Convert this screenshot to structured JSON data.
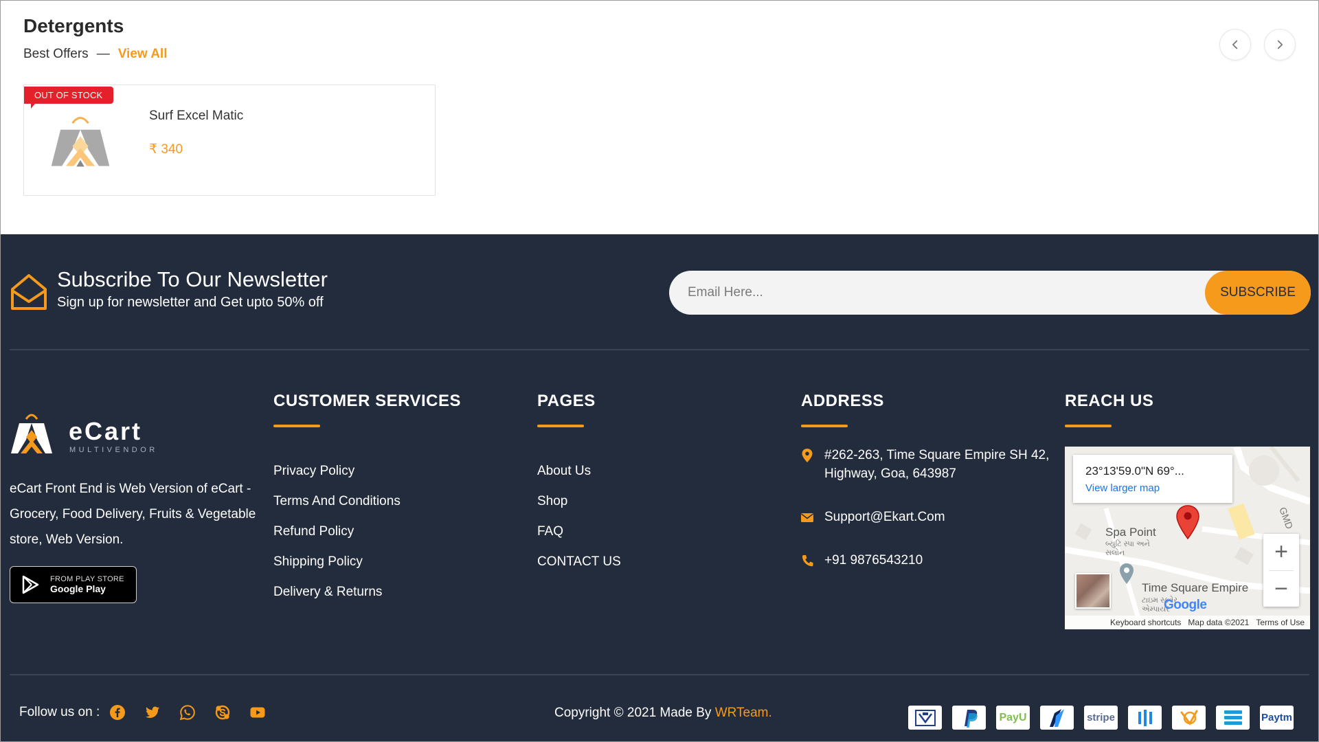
{
  "section": {
    "title": "Detergents",
    "subtitle": "Best Offers",
    "separator": "—",
    "view_all": "View All"
  },
  "product": {
    "badge": "OUT OF STOCK",
    "name": "Surf Excel Matic",
    "price": "₹ 340"
  },
  "newsletter": {
    "title": "Subscribe To Our Newsletter",
    "subtitle": "Sign up for newsletter and Get upto 50% off",
    "placeholder": "Email Here...",
    "button": "SUBSCRIBE"
  },
  "brand": {
    "logo_text": "eCart",
    "logo_sub": "MULTIVENDOR",
    "description": "eCart Front End is Web Version of eCart - Grocery, Food Delivery, Fruits & Vegetable store, Web Version.",
    "store_line1": "FROM PLAY STORE",
    "store_line2": "Google Play"
  },
  "customer_services": {
    "title": "CUSTOMER SERVICES",
    "links": [
      "Privacy Policy",
      "Terms And Conditions",
      "Refund Policy",
      "Shipping Policy",
      "Delivery & Returns"
    ]
  },
  "pages": {
    "title": "PAGES",
    "links": [
      "About Us",
      "Shop",
      "FAQ",
      "CONTACT US"
    ]
  },
  "address": {
    "title": "ADDRESS",
    "location": "#262-263, Time Square Empire SH 42, Highway, Goa, 643987",
    "email": "Support@Ekart.Com",
    "phone": "+91 9876543210"
  },
  "reach_us": {
    "title": "REACH US",
    "map": {
      "coords": "23°13'59.0\"N 69°...",
      "larger_map": "View larger map",
      "label_spa": "Spa Point",
      "label_spa_local": "બ્યુટિ સ્પા અને સલોન",
      "label_tse": "Time Square Empire",
      "label_tse_local": "ટાઇમ સ્ક્વેર એમ્પાયર",
      "label_road": "GMD",
      "google": "Google",
      "keyboard": "Keyboard shortcuts",
      "map_data": "Map data ©2021",
      "terms": "Terms of Use"
    }
  },
  "bottom": {
    "follow_label": "Follow us on :",
    "copyright_prefix": "Copyright © 2021 Made By ",
    "copyright_brand": "WRTeam.",
    "payments": [
      "Indian Bank",
      "PayPal",
      "PayU",
      "Razorpay",
      "stripe",
      "Flutterwave",
      "Paystack",
      "Midtrans",
      "Paytm"
    ]
  },
  "colors": {
    "accent": "#f59a1b",
    "footer_bg": "#232c3d",
    "badge_red": "#e4212b"
  }
}
